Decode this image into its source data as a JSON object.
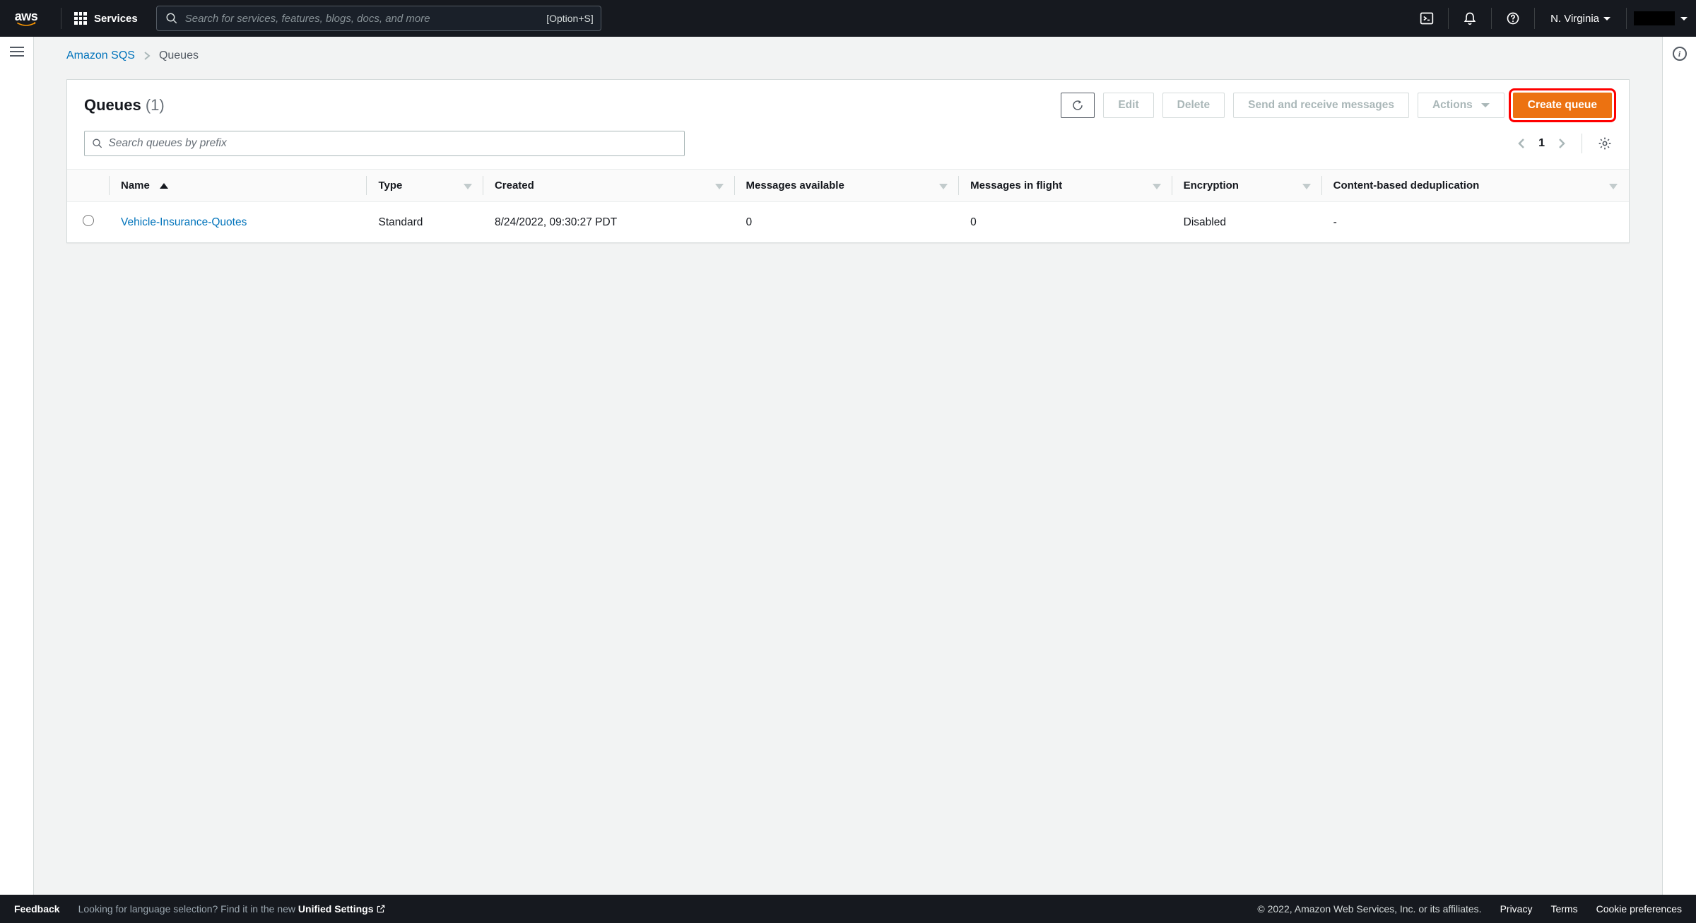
{
  "topnav": {
    "services_label": "Services",
    "search_placeholder": "Search for services, features, blogs, docs, and more",
    "search_shortcut": "[Option+S]",
    "region": "N. Virginia"
  },
  "breadcrumb": {
    "service": "Amazon SQS",
    "current": "Queues"
  },
  "panel": {
    "title": "Queues",
    "count_display": "(1)",
    "buttons": {
      "edit": "Edit",
      "delete": "Delete",
      "send_receive": "Send and receive messages",
      "actions": "Actions",
      "create": "Create queue"
    },
    "search_placeholder": "Search queues by prefix",
    "page_number": "1"
  },
  "table": {
    "columns": {
      "name": "Name",
      "type": "Type",
      "created": "Created",
      "messages_available": "Messages available",
      "messages_in_flight": "Messages in flight",
      "encryption": "Encryption",
      "dedup": "Content-based deduplication"
    },
    "rows": [
      {
        "name": "Vehicle-Insurance-Quotes",
        "type": "Standard",
        "created": "8/24/2022, 09:30:27 PDT",
        "messages_available": "0",
        "messages_in_flight": "0",
        "encryption": "Disabled",
        "dedup": "-"
      }
    ]
  },
  "footer": {
    "feedback": "Feedback",
    "lang_hint_prefix": "Looking for language selection? Find it in the new ",
    "lang_hint_link": "Unified Settings",
    "copyright": "© 2022, Amazon Web Services, Inc. or its affiliates.",
    "privacy": "Privacy",
    "terms": "Terms",
    "cookie": "Cookie preferences"
  }
}
